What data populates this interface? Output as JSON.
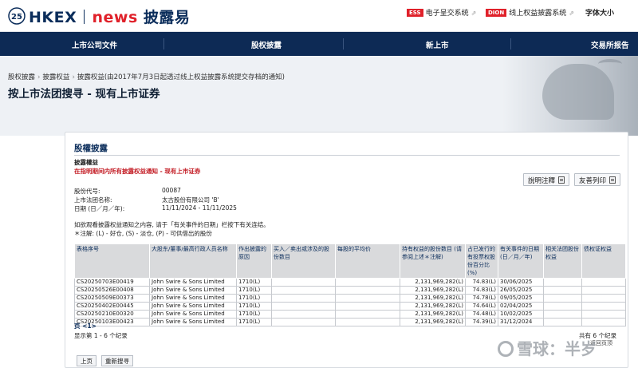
{
  "header": {
    "anniversary": "25",
    "brand": "HKEX",
    "brand_news": "news",
    "brand_cn": "披露易",
    "ess_badge": "ESS",
    "ess_label": "电子呈交系统",
    "dion_badge": "DION",
    "dion_label": "线上权益披露系统",
    "font_size_label": "字体大小"
  },
  "nav": {
    "items": [
      {
        "label": "上市公司文件"
      },
      {
        "label": "股权披露"
      },
      {
        "label": "新上市"
      },
      {
        "label": "交易所报告"
      }
    ]
  },
  "breadcrumb": [
    "股权披露",
    "披露权益",
    "披露权益(由2017年7月3日起透过线上权益披露系统提交存档的通知)"
  ],
  "page_title": "按上市法团搜寻 - 现有上市证券",
  "panel": {
    "title": "股權披露",
    "subtitle": "披露權益",
    "red_note": "在指明期间内所有披露权益通知 - 现有上市证券",
    "explain_button": "說明注釋",
    "print_button": "友善列印",
    "stock_code_label": "股份代号:",
    "stock_code_value": "00087",
    "corp_label": "上市法团名称:",
    "corp_value": "太古股份有限公司 'B'",
    "date_label": "日期 (日／月／年):",
    "date_value": "11/11/2024 - 11/11/2025",
    "note_line1": "如欲观看披露权益通知之内容, 请于「有关事件的日期」栏按下有关连结。",
    "note_line2": "＊注解: (L) - 好仓, (S) - 淡仓, (P) - 可供借出的股份"
  },
  "table": {
    "headers": [
      "表格序号",
      "大股东/董事/最高行政人员名称",
      "作出披露的原因",
      "买入／卖出或涉及的股份数目",
      "每股的平均价",
      "持有权益的股份数目 (请参阅上述＊注解)",
      "占已发行的有投票权股份百分比 (%)",
      "有关事件的日期 (日／月／年)",
      "相关法团股份权益",
      "债权证权益"
    ],
    "rows": [
      {
        "form": "CS20250703E00419",
        "name": "John Swire & Sons Limited",
        "reason": "1710(L)",
        "shares": "2,131,969,282(L)",
        "pct": "74.83(L)",
        "date": "30/06/2025"
      },
      {
        "form": "CS20250526E00408",
        "name": "John Swire & Sons Limited",
        "reason": "1710(L)",
        "shares": "2,131,969,282(L)",
        "pct": "74.83(L)",
        "date": "26/05/2025"
      },
      {
        "form": "CS20250509E00373",
        "name": "John Swire & Sons Limited",
        "reason": "1710(L)",
        "shares": "2,131,969,282(L)",
        "pct": "74.78(L)",
        "date": "09/05/2025"
      },
      {
        "form": "CS20250402E00445",
        "name": "John Swire & Sons Limited",
        "reason": "1710(L)",
        "shares": "2,131,969,282(L)",
        "pct": "74.64(L)",
        "date": "02/04/2025"
      },
      {
        "form": "CS20250210E00320",
        "name": "John Swire & Sons Limited",
        "reason": "1710(L)",
        "shares": "2,131,969,282(L)",
        "pct": "74.48(L)",
        "date": "10/02/2025"
      },
      {
        "form": "CS20250103E00423",
        "name": "John Swire & Sons Limited",
        "reason": "1710(L)",
        "shares": "2,131,969,282(L)",
        "pct": "74.39(L)",
        "date": "31/12/2024"
      }
    ]
  },
  "pager": "页 <1>",
  "showing": "显示第 1 - 6 个纪录",
  "total": "共有 6 个纪录",
  "back_to_top": "返回页顶",
  "buttons": {
    "top": "上页",
    "new_search": "重新搜寻"
  },
  "watermark": "雪球：半岁"
}
